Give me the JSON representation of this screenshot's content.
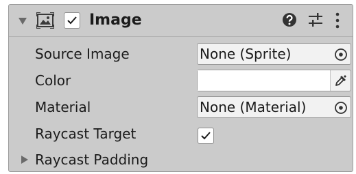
{
  "component": {
    "title": "Image",
    "enabled": true,
    "expanded": true,
    "icons": [
      "foldout-arrow-icon",
      "image-component-icon",
      "help-icon",
      "presets-icon",
      "context-menu-icon"
    ]
  },
  "fields": {
    "source_image": {
      "label": "Source Image",
      "value": "None (Sprite)",
      "picker_icon": "object-picker-icon"
    },
    "color": {
      "label": "Color",
      "value": "#ffffff",
      "picker_icon": "eyedropper-icon"
    },
    "material": {
      "label": "Material",
      "value": "None (Material)",
      "picker_icon": "object-picker-icon"
    },
    "raycast_target": {
      "label": "Raycast Target",
      "checked": true
    },
    "raycast_padding": {
      "label": "Raycast Padding",
      "expanded": false
    }
  },
  "colors": {
    "panel_background": "#cbcbcb",
    "field_background": "#f2f2f2",
    "border": "#9a9a9a"
  }
}
